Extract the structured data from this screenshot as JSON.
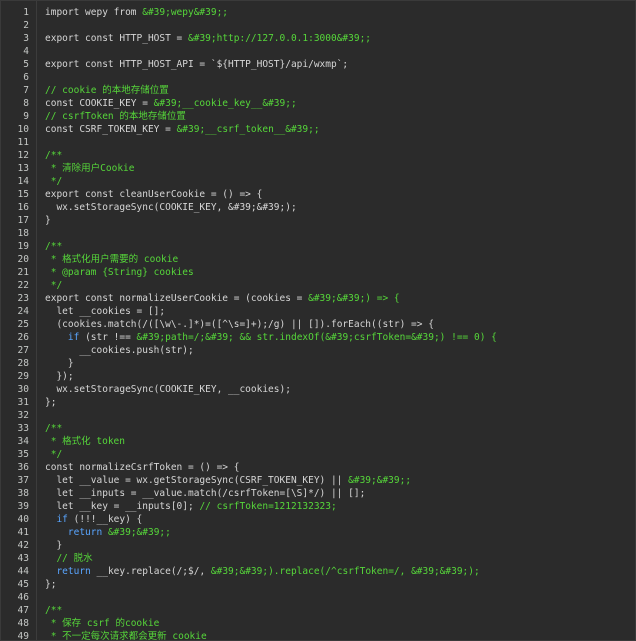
{
  "editor": {
    "lines": [
      {
        "n": "1",
        "segs": [
          {
            "t": "import wepy from ",
            "c": "plain"
          },
          {
            "t": "&#39;wepy&#39;;",
            "c": "green"
          }
        ]
      },
      {
        "n": "2",
        "segs": []
      },
      {
        "n": "3",
        "segs": [
          {
            "t": "export const HTTP_HOST = ",
            "c": "plain"
          },
          {
            "t": "&#39;http://127.0.0.1:3000&#39;;",
            "c": "green"
          }
        ]
      },
      {
        "n": "4",
        "segs": []
      },
      {
        "n": "5",
        "segs": [
          {
            "t": "export const HTTP_HOST_API = `${HTTP_HOST}/api/wxmp`;",
            "c": "plain"
          }
        ]
      },
      {
        "n": "6",
        "segs": []
      },
      {
        "n": "7",
        "segs": [
          {
            "t": "// cookie 的本地存储位置",
            "c": "green"
          }
        ]
      },
      {
        "n": "8",
        "segs": [
          {
            "t": "const COOKIE_KEY = ",
            "c": "plain"
          },
          {
            "t": "&#39;__cookie_key__&#39;;",
            "c": "green"
          }
        ]
      },
      {
        "n": "9",
        "segs": [
          {
            "t": "// csrfToken 的本地存储位置",
            "c": "green"
          }
        ]
      },
      {
        "n": "10",
        "segs": [
          {
            "t": "const CSRF_TOKEN_KEY = ",
            "c": "plain"
          },
          {
            "t": "&#39;__csrf_token__&#39;;",
            "c": "green"
          }
        ]
      },
      {
        "n": "11",
        "segs": []
      },
      {
        "n": "12",
        "segs": [
          {
            "t": "/**",
            "c": "green"
          }
        ]
      },
      {
        "n": "13",
        "segs": [
          {
            "t": " * 清除用户Cookie",
            "c": "green"
          }
        ]
      },
      {
        "n": "14",
        "segs": [
          {
            "t": " */",
            "c": "green"
          }
        ]
      },
      {
        "n": "15",
        "segs": [
          {
            "t": "export const cleanUserCookie = () => {",
            "c": "plain"
          }
        ]
      },
      {
        "n": "16",
        "segs": [
          {
            "t": "  wx.setStorageSync(COOKIE_KEY, &#39;&#39;);",
            "c": "plain"
          }
        ]
      },
      {
        "n": "17",
        "segs": [
          {
            "t": "}",
            "c": "plain"
          }
        ]
      },
      {
        "n": "18",
        "segs": []
      },
      {
        "n": "19",
        "segs": [
          {
            "t": "/**",
            "c": "green"
          }
        ]
      },
      {
        "n": "20",
        "segs": [
          {
            "t": " * 格式化用户需要的 cookie",
            "c": "green"
          }
        ]
      },
      {
        "n": "21",
        "segs": [
          {
            "t": " * @param {String} cookies",
            "c": "green"
          }
        ]
      },
      {
        "n": "22",
        "segs": [
          {
            "t": " */",
            "c": "green"
          }
        ]
      },
      {
        "n": "23",
        "segs": [
          {
            "t": "export const normalizeUserCookie = (cookies = ",
            "c": "plain"
          },
          {
            "t": "&#39;&#39;) => {",
            "c": "green"
          }
        ]
      },
      {
        "n": "24",
        "segs": [
          {
            "t": "  let __cookies = [];",
            "c": "plain"
          }
        ]
      },
      {
        "n": "25",
        "segs": [
          {
            "t": "  (cookies.match(/([\\w\\-.]*)=([^\\s=]+);/g) || []).forEach((str) => {",
            "c": "plain"
          }
        ]
      },
      {
        "n": "26",
        "segs": [
          {
            "t": "    ",
            "c": "plain"
          },
          {
            "t": "if",
            "c": "blue"
          },
          {
            "t": " (str !== ",
            "c": "plain"
          },
          {
            "t": "&#39;path=/;&#39; && str.indexOf(&#39;csrfToken=&#39;) !== 0) {",
            "c": "green"
          }
        ]
      },
      {
        "n": "27",
        "segs": [
          {
            "t": "      __cookies.push(str);",
            "c": "plain"
          }
        ]
      },
      {
        "n": "28",
        "segs": [
          {
            "t": "    }",
            "c": "plain"
          }
        ]
      },
      {
        "n": "29",
        "segs": [
          {
            "t": "  });",
            "c": "plain"
          }
        ]
      },
      {
        "n": "30",
        "segs": [
          {
            "t": "  wx.setStorageSync(COOKIE_KEY, __cookies);",
            "c": "plain"
          }
        ]
      },
      {
        "n": "31",
        "segs": [
          {
            "t": "};",
            "c": "plain"
          }
        ]
      },
      {
        "n": "32",
        "segs": []
      },
      {
        "n": "33",
        "segs": [
          {
            "t": "/**",
            "c": "green"
          }
        ]
      },
      {
        "n": "34",
        "segs": [
          {
            "t": " * 格式化 token",
            "c": "green"
          }
        ]
      },
      {
        "n": "35",
        "segs": [
          {
            "t": " */",
            "c": "green"
          }
        ]
      },
      {
        "n": "36",
        "segs": [
          {
            "t": "const normalizeCsrfToken = () => {",
            "c": "plain"
          }
        ]
      },
      {
        "n": "37",
        "segs": [
          {
            "t": "  let __value = wx.getStorageSync(CSRF_TOKEN_KEY) || ",
            "c": "plain"
          },
          {
            "t": "&#39;&#39;;",
            "c": "green"
          }
        ]
      },
      {
        "n": "38",
        "segs": [
          {
            "t": "  let __inputs = __value.match(/csrfToken=[\\S]*/) || [];",
            "c": "plain"
          }
        ]
      },
      {
        "n": "39",
        "segs": [
          {
            "t": "  let __key = __inputs[0]; ",
            "c": "plain"
          },
          {
            "t": "// csrfToken=1212132323;",
            "c": "green"
          }
        ]
      },
      {
        "n": "40",
        "segs": [
          {
            "t": "  ",
            "c": "plain"
          },
          {
            "t": "if",
            "c": "blue"
          },
          {
            "t": " (!!!__key) {",
            "c": "plain"
          }
        ]
      },
      {
        "n": "41",
        "segs": [
          {
            "t": "    ",
            "c": "plain"
          },
          {
            "t": "return",
            "c": "blue"
          },
          {
            "t": " ",
            "c": "plain"
          },
          {
            "t": "&#39;&#39;;",
            "c": "green"
          }
        ]
      },
      {
        "n": "42",
        "segs": [
          {
            "t": "  }",
            "c": "plain"
          }
        ]
      },
      {
        "n": "43",
        "segs": [
          {
            "t": "  // 脱水",
            "c": "green"
          }
        ]
      },
      {
        "n": "44",
        "segs": [
          {
            "t": "  ",
            "c": "plain"
          },
          {
            "t": "return",
            "c": "blue"
          },
          {
            "t": " __key.replace(/;$/, ",
            "c": "plain"
          },
          {
            "t": "&#39;&#39;).replace(/^csrfToken=/, &#39;&#39;);",
            "c": "green"
          }
        ]
      },
      {
        "n": "45",
        "segs": [
          {
            "t": "};",
            "c": "plain"
          }
        ]
      },
      {
        "n": "46",
        "segs": []
      },
      {
        "n": "47",
        "segs": [
          {
            "t": "/**",
            "c": "green"
          }
        ]
      },
      {
        "n": "48",
        "segs": [
          {
            "t": " * 保存 csrf 的cookie",
            "c": "green"
          }
        ]
      },
      {
        "n": "49",
        "segs": [
          {
            "t": " * 不一定每次请求都会更新 cookie",
            "c": "green"
          }
        ]
      }
    ]
  },
  "colors": {
    "plain": "#d6d6d6",
    "green": "#56d63a",
    "blue": "#59a5ff",
    "line_number": "#c5c8c6",
    "background": "#2b2b2b"
  }
}
